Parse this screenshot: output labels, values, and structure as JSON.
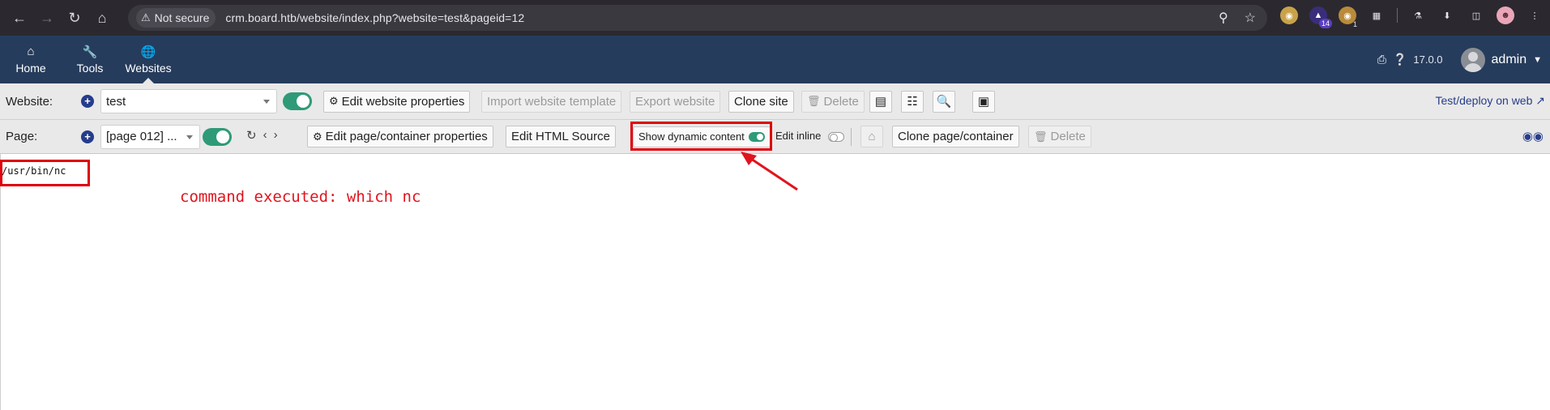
{
  "browser": {
    "security_label": "Not secure",
    "url": "crm.board.htb/website/index.php?website=test&pageid=12",
    "ext_badge_count": "14",
    "ext_badge_small": "1"
  },
  "topmenu": {
    "items": [
      {
        "label": "Home",
        "icon": "home-icon"
      },
      {
        "label": "Tools",
        "icon": "wrench-icon"
      },
      {
        "label": "Websites",
        "icon": "globe-icon"
      }
    ],
    "active": "Websites",
    "version": "17.0.0",
    "user": "admin"
  },
  "website_bar": {
    "label": "Website:",
    "selected_site": "test",
    "enabled": true,
    "buttons": {
      "edit_props": "Edit website properties",
      "import_template": "Import website template",
      "export": "Export website",
      "clone": "Clone site",
      "delete": "Delete"
    },
    "deploy_link": "Test/deploy on web"
  },
  "page_bar": {
    "label": "Page:",
    "selected_page": "[page 012] ...",
    "enabled": true,
    "buttons": {
      "edit_page_props": "Edit page/container properties",
      "edit_html": "Edit HTML Source",
      "show_dynamic": "Show dynamic content",
      "edit_inline": "Edit inline",
      "clone_page": "Clone page/container",
      "delete": "Delete"
    },
    "show_dynamic_on": true,
    "edit_inline_on": false
  },
  "content": {
    "output": "/usr/bin/nc",
    "annotation": "command executed: which nc"
  },
  "colors": {
    "menu_bg": "#263c5c",
    "toolbar_bg": "#e9e9e9",
    "toggle_green": "#2e9a78",
    "annotation_red": "#e0141e"
  }
}
